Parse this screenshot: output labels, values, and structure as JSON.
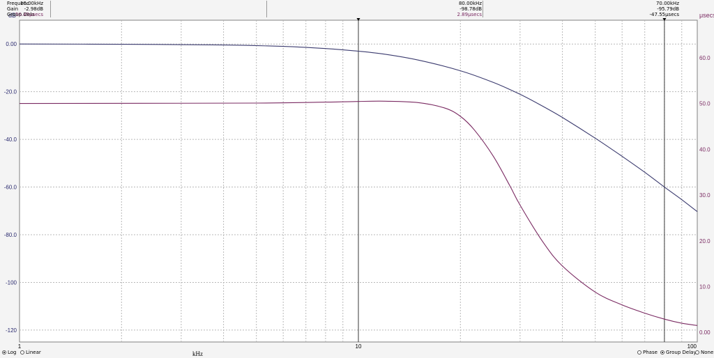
{
  "readout": {
    "rows": [
      {
        "label": "Frequenc",
        "c1": "10.00kHz",
        "c2": "80.00kHz",
        "c3": "70.00kHz"
      },
      {
        "label": "Gain",
        "c1": "-2.98dB",
        "c2": "-98.78dB",
        "c3": "-95.79dB"
      },
      {
        "label": "Group Dela",
        "c1": "50.45μsecs",
        "c2": "2.89μsecs",
        "c3": "-47.55μsecs"
      }
    ]
  },
  "chart_data": {
    "type": "line",
    "xlabel": "kHz",
    "xscale": "log",
    "xlim": [
      1,
      100
    ],
    "x_tick_labels": [
      "1",
      "10",
      "100"
    ],
    "ylabel_left": "dB",
    "ylim_left": [
      -125,
      10
    ],
    "y_tick_labels_left": [
      "0.00",
      "-20.0",
      "-40.0",
      "-60.0",
      "-80.0",
      "-100",
      "-120"
    ],
    "ylabel_right": "μsecs",
    "ylim_right": [
      -2.1,
      68.2
    ],
    "y_tick_labels_right": [
      "60.0",
      "50.0",
      "40.0",
      "30.0",
      "20.0",
      "10.0",
      "0.00"
    ],
    "grid": true,
    "cursors_khz": [
      10,
      80
    ],
    "series": [
      {
        "axis": "left",
        "color": "#3a3a6e",
        "x": [
          1,
          2,
          4,
          6,
          8,
          10,
          12,
          15,
          20,
          25,
          30,
          35,
          40,
          50,
          60,
          70,
          80,
          90,
          100
        ],
        "y": [
          0,
          -0.1,
          -0.4,
          -1.0,
          -1.9,
          -3.0,
          -4.3,
          -6.7,
          -11.2,
          -16.1,
          -21.1,
          -26.1,
          -30.8,
          -39.5,
          -47.1,
          -53.8,
          -60.0,
          -65.3,
          -70.3
        ]
      },
      {
        "axis": "right",
        "color": "#7a2a62",
        "x": [
          1,
          5,
          8,
          10,
          12,
          15,
          18,
          20,
          22,
          25,
          28,
          30,
          35,
          40,
          50,
          60,
          70,
          80,
          90,
          100
        ],
        "y": [
          50.0,
          50.1,
          50.3,
          50.45,
          50.5,
          50.2,
          49.0,
          47.2,
          44.2,
          38.5,
          32.0,
          27.8,
          19.8,
          14.5,
          8.8,
          6.0,
          4.2,
          2.89,
          2.0,
          1.5
        ]
      }
    ]
  },
  "bottom": {
    "log_label": "Log",
    "linear_label": "Linear",
    "phase_label": "Phase",
    "gd_label": "Group Delay",
    "none_label": "None"
  }
}
